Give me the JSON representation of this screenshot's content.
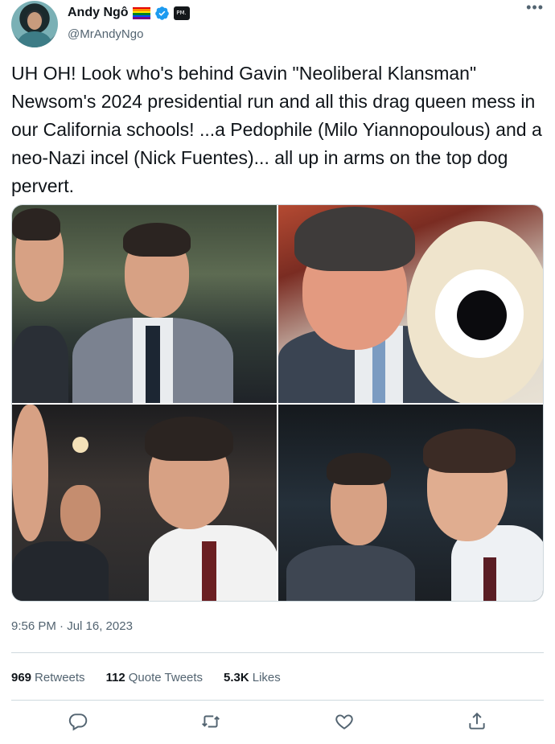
{
  "author": {
    "display_name": "Andy Ngô",
    "handle": "@MrAndyNgo",
    "affiliate_badge": "PM.",
    "icons": [
      "pride-flag-icon",
      "verified-badge-icon",
      "affiliate-badge-icon"
    ]
  },
  "tweet": {
    "text": "UH OH! Look who's behind Gavin \"Neoliberal Klansman\" Newsom's 2024 presidential run and all this drag queen mess in our California schools! ...a Pedophile (Milo Yiannopoulous) and a neo-Nazi incel (Nick Fuentes)... all up in arms on the top dog pervert.",
    "timestamp": "9:56 PM · Jul 16, 2023"
  },
  "stats": {
    "retweets_count": "969",
    "retweets_label": "Retweets",
    "quotes_count": "112",
    "quotes_label": "Quote Tweets",
    "likes_count": "5.3K",
    "likes_label": "Likes"
  },
  "actions": [
    "reply-icon",
    "retweet-icon",
    "like-icon",
    "share-icon"
  ],
  "colors": {
    "text": "#0f1419",
    "secondary": "#536471",
    "verified": "#1d9bf0",
    "divider": "#cfd9de"
  }
}
